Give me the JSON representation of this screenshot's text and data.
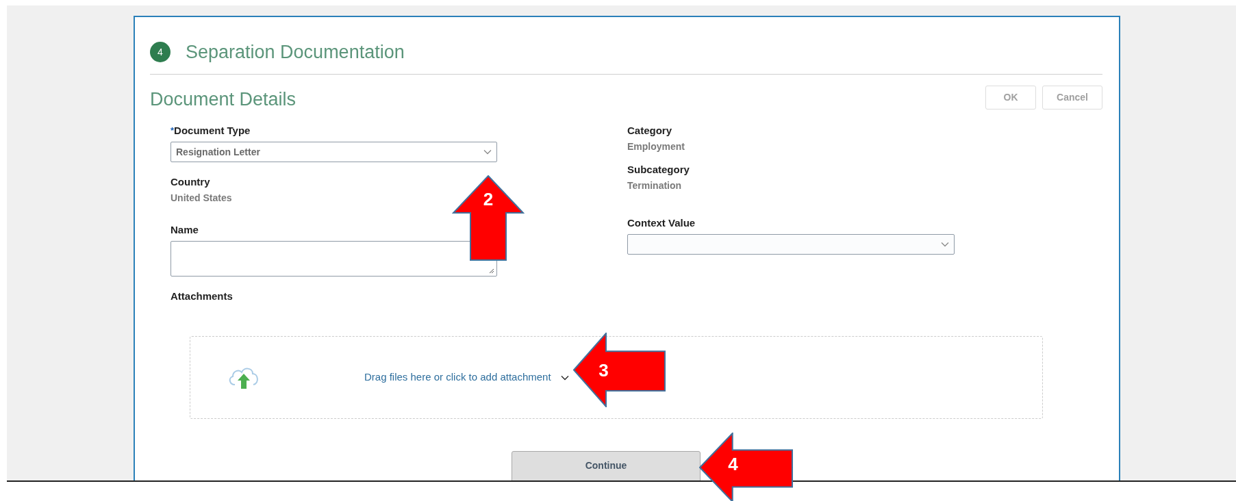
{
  "step": {
    "number": "4",
    "title": "Separation Documentation"
  },
  "section": {
    "title": "Document Details",
    "buttons": [
      {
        "label": "OK",
        "disabled": true
      },
      {
        "label": "Cancel",
        "disabled": true
      }
    ]
  },
  "left_fields": [
    {
      "kind": "select",
      "label": "Document Type",
      "required": true,
      "value": "Resignation Letter"
    },
    {
      "kind": "readonly",
      "label": "Country",
      "value": "United States"
    },
    {
      "kind": "textarea",
      "label": "Name"
    },
    {
      "kind": "heading",
      "label": "Attachments"
    }
  ],
  "right_fields": [
    {
      "kind": "readonly",
      "label": "Category",
      "value": "Employment"
    },
    {
      "kind": "readonly",
      "label": "Subcategory",
      "value": "Termination"
    },
    {
      "kind": "select",
      "label": "Context Value"
    }
  ],
  "required_mark": "*",
  "dropzone": {
    "text": "Drag files here or click to add attachment"
  },
  "continue_button": {
    "label": "Continue"
  },
  "callouts": [
    {
      "number": "2",
      "kind": "up"
    },
    {
      "number": "3",
      "kind": "left"
    },
    {
      "number": "4",
      "kind": "left"
    }
  ]
}
